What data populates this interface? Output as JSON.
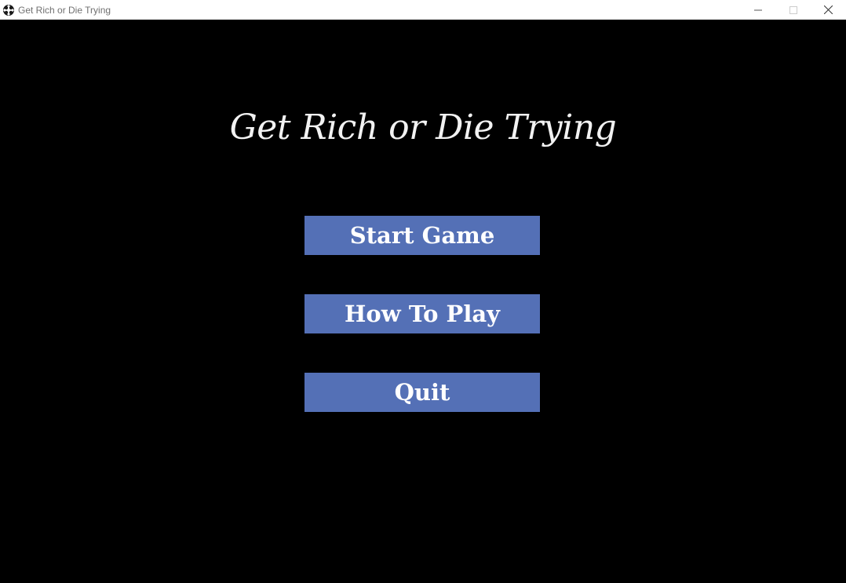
{
  "window": {
    "title": "Get Rich or Die Trying",
    "icon": "app-logo-icon",
    "controls": [
      "minimize-icon",
      "maximize-icon",
      "close-icon"
    ]
  },
  "game": {
    "title": "Get Rich or Die Trying",
    "menu": {
      "start_label": "Start Game",
      "howto_label": "How To Play",
      "quit_label": "Quit"
    }
  },
  "colors": {
    "background": "#000000",
    "button": "#5470b6",
    "text": "#ffffff",
    "titlebar": "#ffffff"
  }
}
